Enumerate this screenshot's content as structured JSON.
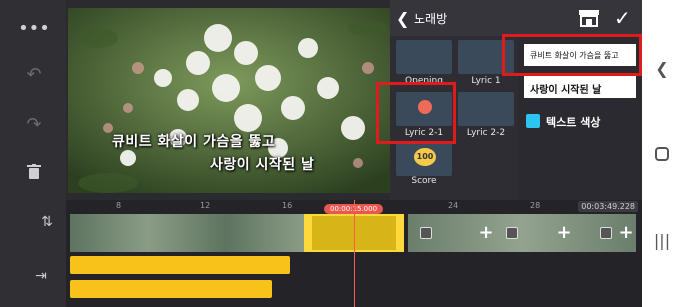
{
  "panel": {
    "title": "노래방",
    "thumbnails": [
      {
        "label": "Opening"
      },
      {
        "label": "Lyric 1"
      },
      {
        "label": "Lyric 2-1"
      },
      {
        "label": "Lyric 2-2"
      },
      {
        "label": "Score",
        "badge": "100"
      }
    ],
    "fields": {
      "lyric_line1": "큐비트 화살이 가슴을 뚫고",
      "lyric_line2": "사랑이 시작된 날"
    },
    "text_color_label": "텍스트 색상",
    "text_color": "#2ec4f1"
  },
  "preview": {
    "lyric_line1": "큐비트 화살이 가슴을 뚫고",
    "lyric_line2": "사랑이 시작된 날"
  },
  "timeline": {
    "ruler": [
      "8",
      "12",
      "16",
      "24",
      "28"
    ],
    "current_time": "00:03:49.228",
    "selected_label": "00:00:15.000"
  },
  "accent": "#ffd93a",
  "highlight": "#e01b1b"
}
